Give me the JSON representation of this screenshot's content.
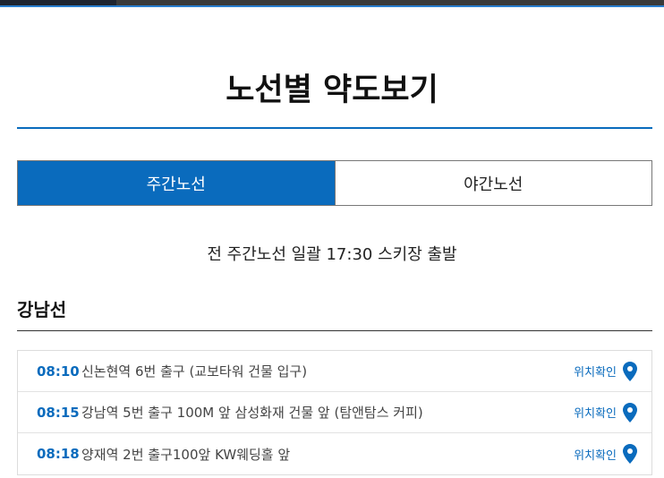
{
  "page": {
    "title": "노선별 약도보기"
  },
  "tabs": [
    {
      "label": "주간노선",
      "active": true
    },
    {
      "label": "야간노선",
      "active": false
    }
  ],
  "notice": "전 주간노선 일괄 17:30 스키장 출발",
  "route": {
    "name": "강남선",
    "stops": [
      {
        "time": "08:10",
        "place": "신논현역 6번 출구 (교보타워 건물 입구)",
        "action": "위치확인"
      },
      {
        "time": "08:15",
        "place": "강남역 5번 출구 100M 앞 삼성화재 건물 앞 (탐앤탐스 커피)",
        "action": "위치확인"
      },
      {
        "time": "08:18",
        "place": "양재역 2번 출구100앞 KW웨딩홀 앞",
        "action": "위치확인"
      }
    ]
  },
  "colors": {
    "accent": "#0a6bbd",
    "pin": "#0a6bbd"
  },
  "icons": {
    "location": "map-pin-icon"
  }
}
